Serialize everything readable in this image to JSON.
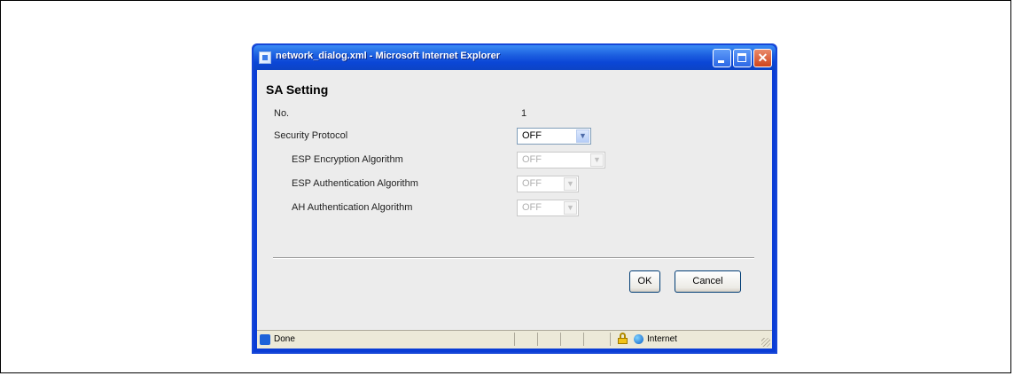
{
  "window": {
    "title": "network_dialog.xml - Microsoft Internet Explorer",
    "close_glyph": "✕"
  },
  "dialog": {
    "title": "SA Setting",
    "no_label": "No.",
    "no_value": "1",
    "security_protocol": {
      "label": "Security Protocol",
      "value": "OFF",
      "enabled": true
    },
    "esp_encryption": {
      "label": "ESP Encryption Algorithm",
      "value": "OFF",
      "enabled": false
    },
    "esp_authentication": {
      "label": "ESP Authentication Algorithm",
      "value": "OFF",
      "enabled": false
    },
    "ah_authentication": {
      "label": "AH Authentication Algorithm",
      "value": "OFF",
      "enabled": false
    },
    "ok_label": "OK",
    "cancel_label": "Cancel"
  },
  "dropdown_arrow": "▼",
  "statusbar": {
    "status": "Done",
    "zone": "Internet",
    "icons": [
      "ie-page-icon",
      "lock-icon",
      "globe-icon"
    ]
  },
  "colors": {
    "titlebar": "#0b46d6",
    "content_bg": "#ececec",
    "statusbar_bg": "#ece9d8",
    "close_button": "#d0451c"
  }
}
